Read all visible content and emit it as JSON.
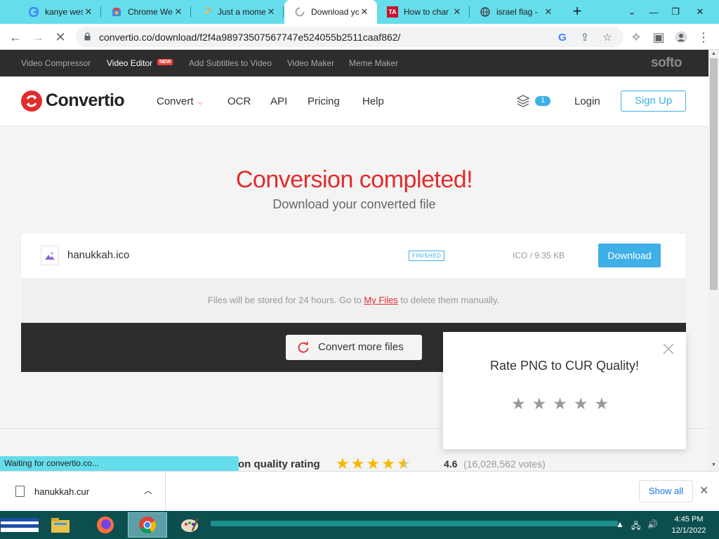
{
  "browser": {
    "tabs": [
      {
        "title": "kanye west -",
        "icon": "google-icon",
        "active": false
      },
      {
        "title": "Chrome Wel",
        "icon": "chrome-store-icon",
        "active": false
      },
      {
        "title": "Just a mome",
        "icon": "loading-spinner-icon",
        "active": false
      },
      {
        "title": "Download yo",
        "icon": "loading-spinner-icon",
        "active": true
      },
      {
        "title": "How to char",
        "icon": "ta-icon",
        "active": false
      },
      {
        "title": "israel flag -",
        "icon": "globe-icon",
        "active": false
      }
    ],
    "url": "convertio.co/download/f2f4a98973507567747e524055b2511caaf862/",
    "status_text": "Waiting for convertio.co..."
  },
  "promo_bar": {
    "links": [
      "Video Compressor",
      "Video Editor",
      "Add Subtitles to Video",
      "Video Maker",
      "Meme Maker"
    ],
    "new_badge": "NEW",
    "brand": "softo"
  },
  "header": {
    "logo": "Convertio",
    "nav": [
      "Convert",
      "OCR",
      "API",
      "Pricing",
      "Help"
    ],
    "layers_count": "1",
    "login": "Login",
    "signup": "Sign Up"
  },
  "main": {
    "headline": "Conversion completed!",
    "subhead": "Download your converted file",
    "file": {
      "name": "hanukkah.ico",
      "status": "FINISHED",
      "meta": "ICO / 9.35 KB",
      "download_label": "Download"
    },
    "store_note_before": "Files will be stored for 24 hours. Go to ",
    "store_note_link": "My Files",
    "store_note_after": " to delete them manually.",
    "convert_more": "Convert more files",
    "rating_label": "on quality rating",
    "rating_score": "4.6",
    "rating_votes": "(16,028,562 votes)",
    "rating_value": 4.6
  },
  "popup": {
    "title": "Rate PNG to CUR Quality!",
    "stars": 5
  },
  "download_shelf": {
    "file_name": "hanukkah.cur",
    "show_all": "Show all"
  },
  "taskbar": {
    "time": "4:45 PM",
    "date": "12/1/2022"
  },
  "colors": {
    "brand_red": "#e32b2b",
    "accent_blue": "#3eb0e6",
    "tab_strip": "#66ddea",
    "star_gold": "#f5b800"
  }
}
